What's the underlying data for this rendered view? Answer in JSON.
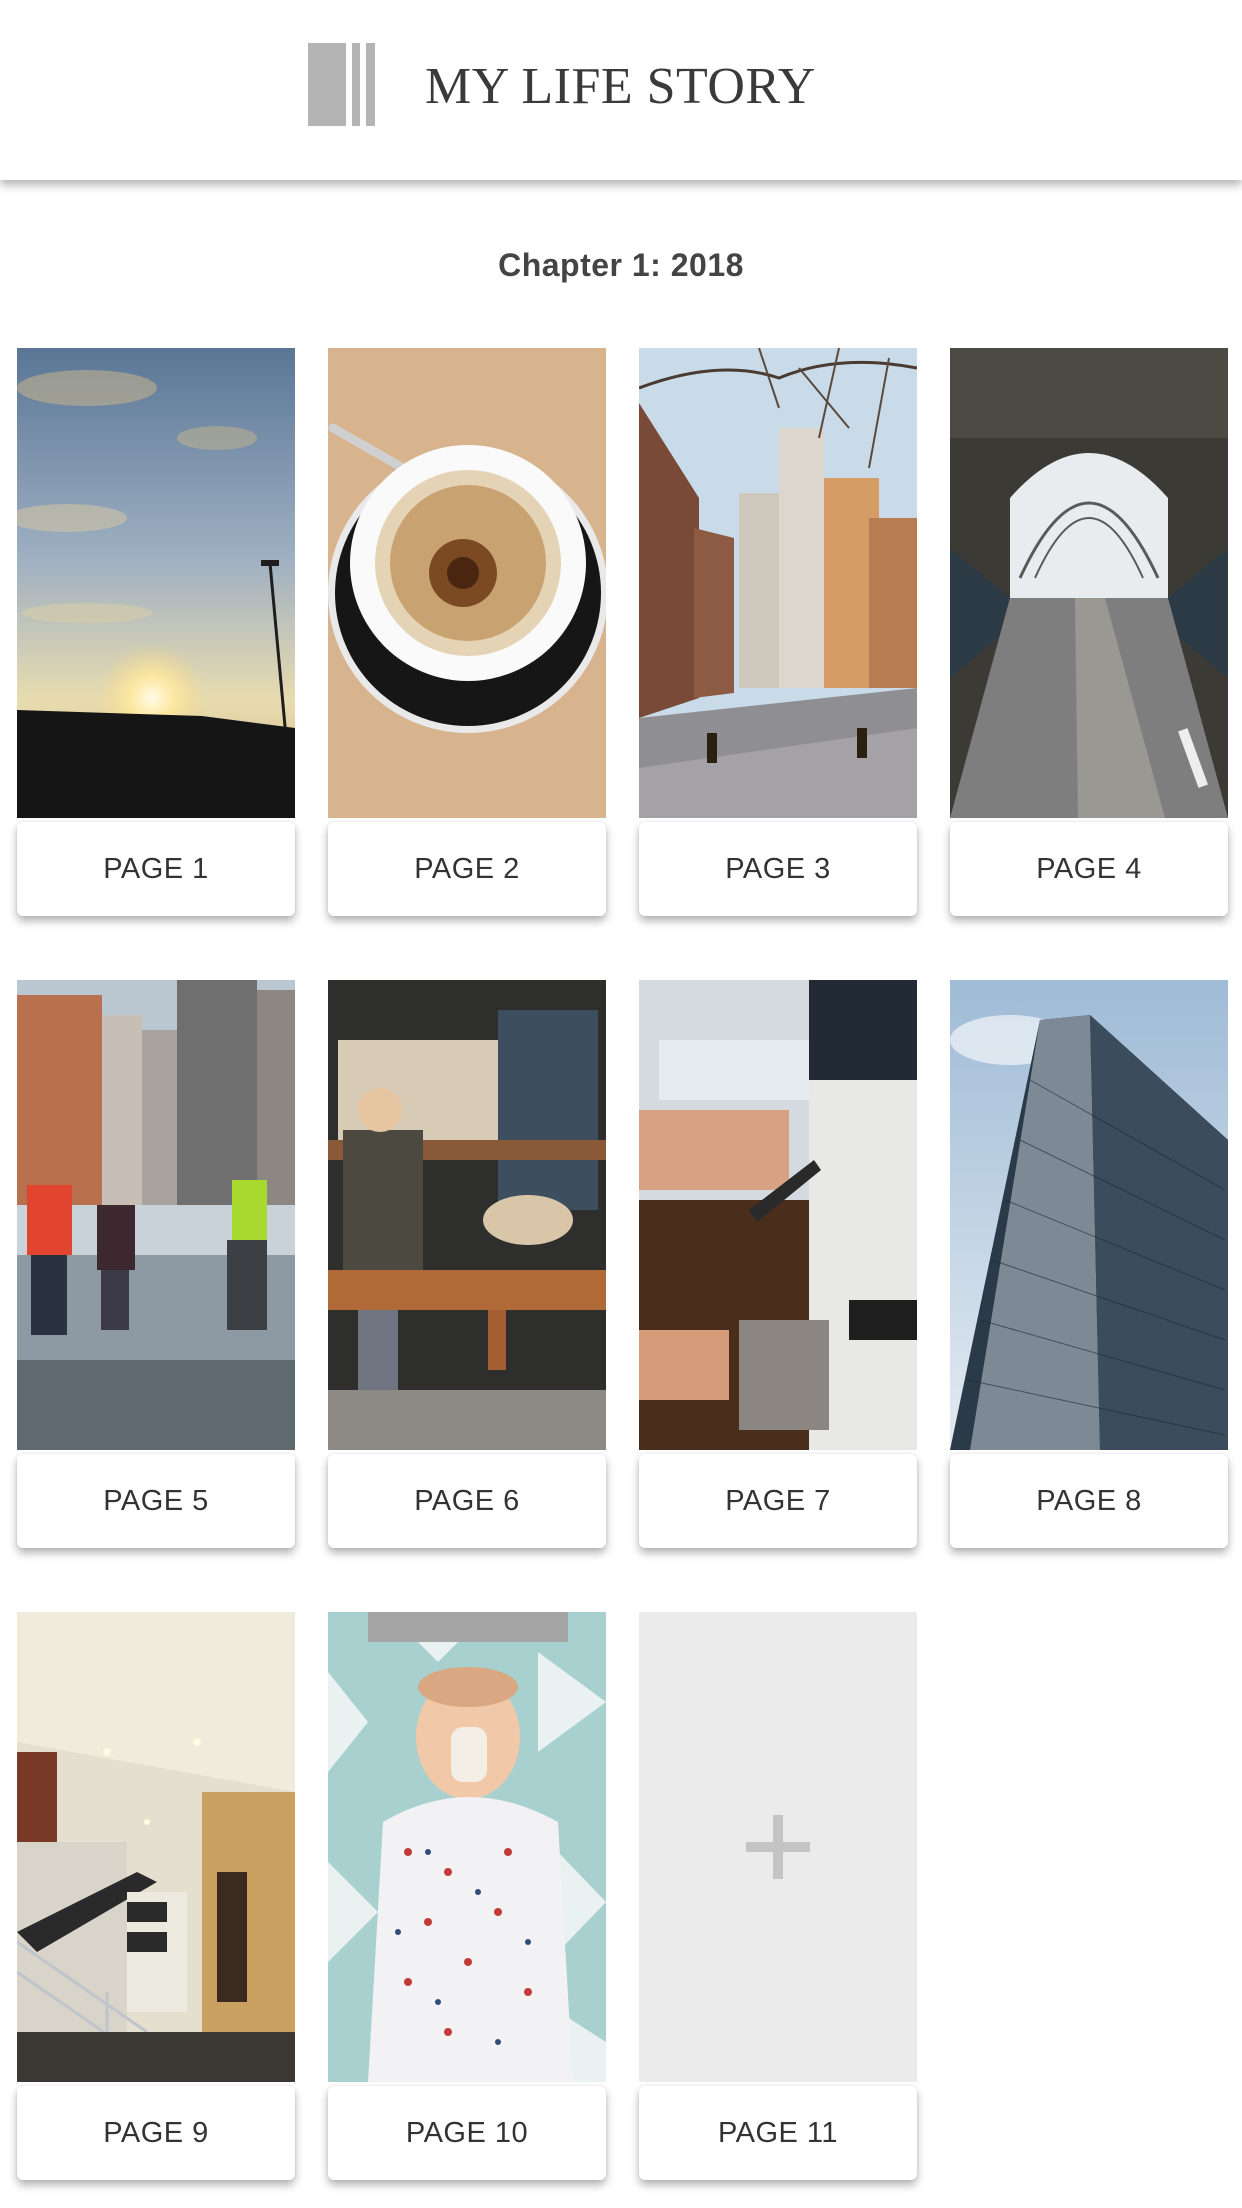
{
  "header": {
    "title": "MY LIFE STORY",
    "logo_icon": "book-spines-icon",
    "logo_color": "#b4b4b4"
  },
  "chapter": {
    "title": "Chapter 1: 2018"
  },
  "pages": [
    {
      "label": "PAGE 1",
      "photo": "sunset-sky"
    },
    {
      "label": "PAGE 2",
      "photo": "espresso-cup"
    },
    {
      "label": "PAGE 3",
      "photo": "city-street"
    },
    {
      "label": "PAGE 4",
      "photo": "arched-walkway"
    },
    {
      "label": "PAGE 5",
      "photo": "beach-walkers"
    },
    {
      "label": "PAGE 6",
      "photo": "cafe-bench"
    },
    {
      "label": "PAGE 7",
      "photo": "barista-steaming"
    },
    {
      "label": "PAGE 8",
      "photo": "glass-tower"
    },
    {
      "label": "PAGE 9",
      "photo": "staircase-lobby"
    },
    {
      "label": "PAGE 10",
      "photo": "baby-bottle"
    }
  ],
  "add_page": {
    "label": "PAGE 11",
    "icon": "plus-icon"
  }
}
